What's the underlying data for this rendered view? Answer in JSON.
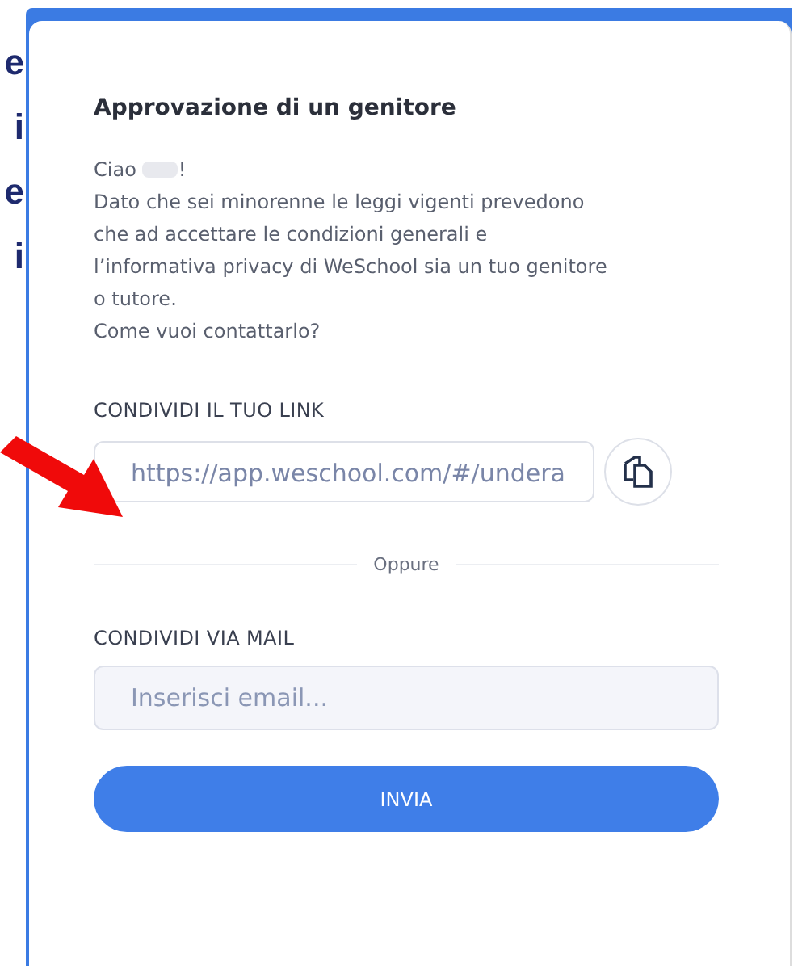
{
  "background_fragments": [
    "e",
    "i",
    "e",
    "i"
  ],
  "dialog": {
    "title": "Approvazione di un genitore",
    "greeting": "Ciao",
    "greeting_end": "!",
    "message_lines": [
      "Dato che sei minorenne le leggi vigenti prevedono",
      "che ad accettare le condizioni generali e",
      "l’informativa privacy di WeSchool sia un tuo genitore",
      "o tutore.",
      "Come vuoi contattarlo?"
    ],
    "link_label": "CONDIVIDI IL TUO LINK",
    "link_value": "https://app.weschool.com/#/undera",
    "divider_text": "Oppure",
    "mail_label": "CONDIVIDI VIA MAIL",
    "email_placeholder": "Inserisci email...",
    "send_button": "INVIA"
  }
}
